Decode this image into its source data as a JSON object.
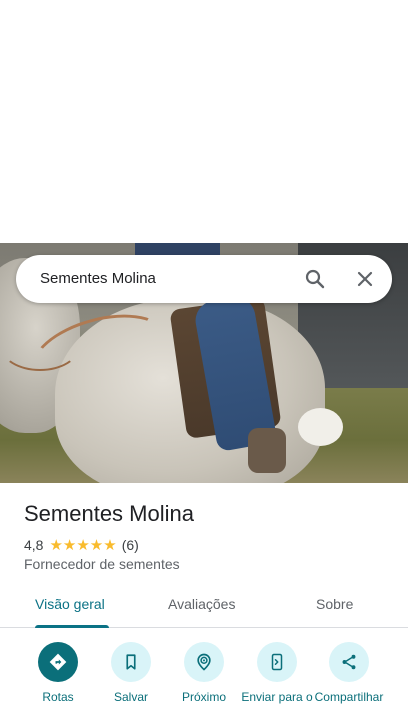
{
  "search": {
    "query": "Sementes Molina"
  },
  "place": {
    "name": "Sementes Molina",
    "rating": "4,8",
    "stars": "★★★★★",
    "review_count": "(6)",
    "category": "Fornecedor de sementes"
  },
  "tabs": [
    {
      "label": "Visão geral",
      "active": true
    },
    {
      "label": "Avaliações",
      "active": false
    },
    {
      "label": "Sobre",
      "active": false
    }
  ],
  "actions": [
    {
      "label": "Rotas",
      "icon": "directions-icon"
    },
    {
      "label": "Salvar",
      "icon": "bookmark-icon"
    },
    {
      "label": "Próximo",
      "icon": "nearby-icon"
    },
    {
      "label": "Enviar para o",
      "icon": "send-to-phone-icon"
    },
    {
      "label": "Compartilhar",
      "icon": "share-icon"
    }
  ],
  "colors": {
    "accent": "#0b7285",
    "action_bg": "#d9f4f8",
    "primary_action_bg": "#0b6f7a",
    "star": "#f9bb2d"
  }
}
